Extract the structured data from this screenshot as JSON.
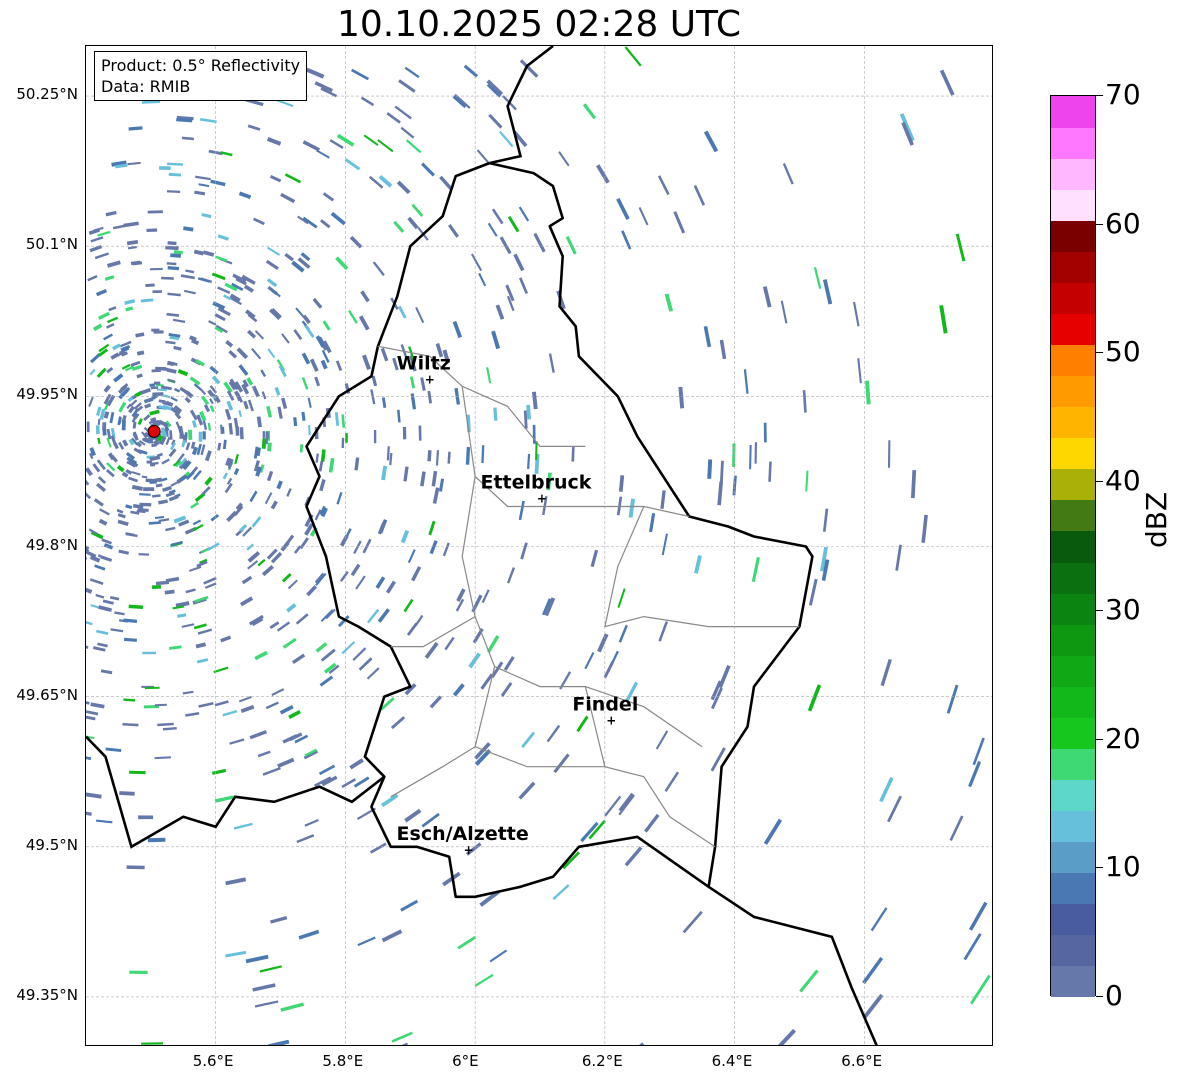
{
  "title": "10.10.2025 02:28 UTC",
  "product_box": {
    "line1": "Product: 0.5° Reflectivity",
    "line2": "Data: RMIB"
  },
  "axes": {
    "lon_range": [
      5.4,
      6.8
    ],
    "lat_range": [
      49.3,
      50.3
    ],
    "lon_ticks": [
      {
        "value": 5.6,
        "label": "5.6°E"
      },
      {
        "value": 5.8,
        "label": "5.8°E"
      },
      {
        "value": 6.0,
        "label": "6°E"
      },
      {
        "value": 6.2,
        "label": "6.2°E"
      },
      {
        "value": 6.4,
        "label": "6.4°E"
      },
      {
        "value": 6.6,
        "label": "6.6°E"
      }
    ],
    "lat_ticks": [
      {
        "value": 50.25,
        "label": "50.25°N"
      },
      {
        "value": 50.1,
        "label": "50.1°N"
      },
      {
        "value": 49.95,
        "label": "49.95°N"
      },
      {
        "value": 49.8,
        "label": "49.8°N"
      },
      {
        "value": 49.65,
        "label": "49.65°N"
      },
      {
        "value": 49.5,
        "label": "49.5°N"
      },
      {
        "value": 49.35,
        "label": "49.35°N"
      }
    ],
    "grid": true
  },
  "radar_site": {
    "lon": 5.505,
    "lat": 49.915,
    "color": "#e00000"
  },
  "cities": [
    {
      "name": "Wiltz",
      "lon": 5.93,
      "lat": 49.967
    },
    {
      "name": "Ettelbruck",
      "lon": 6.103,
      "lat": 49.848
    },
    {
      "name": "Findel",
      "lon": 6.21,
      "lat": 49.626
    },
    {
      "name": "Esch/Alzette",
      "lon": 5.99,
      "lat": 49.497
    }
  ],
  "colorbar": {
    "label": "dBZ",
    "min": 0,
    "max": 70,
    "ticks": [
      "0",
      "10",
      "20",
      "30",
      "40",
      "50",
      "60",
      "70"
    ],
    "colors": [
      "#6677aa",
      "#5566a0",
      "#4a5ca0",
      "#4a78b2",
      "#5a9ec8",
      "#66c0dc",
      "#5dd8c8",
      "#3ed875",
      "#16c81e",
      "#12b81a",
      "#11a816",
      "#0e9812",
      "#0c8412",
      "#0a7010",
      "#0a5a0e",
      "#447a14",
      "#aab008",
      "#ffd700",
      "#ffb400",
      "#ff9b00",
      "#ff7f00",
      "#e60000",
      "#c40000",
      "#a30000",
      "#7a0000",
      "#ffe0ff",
      "#ffb8ff",
      "#ff78ff",
      "#ee44ee"
    ]
  }
}
